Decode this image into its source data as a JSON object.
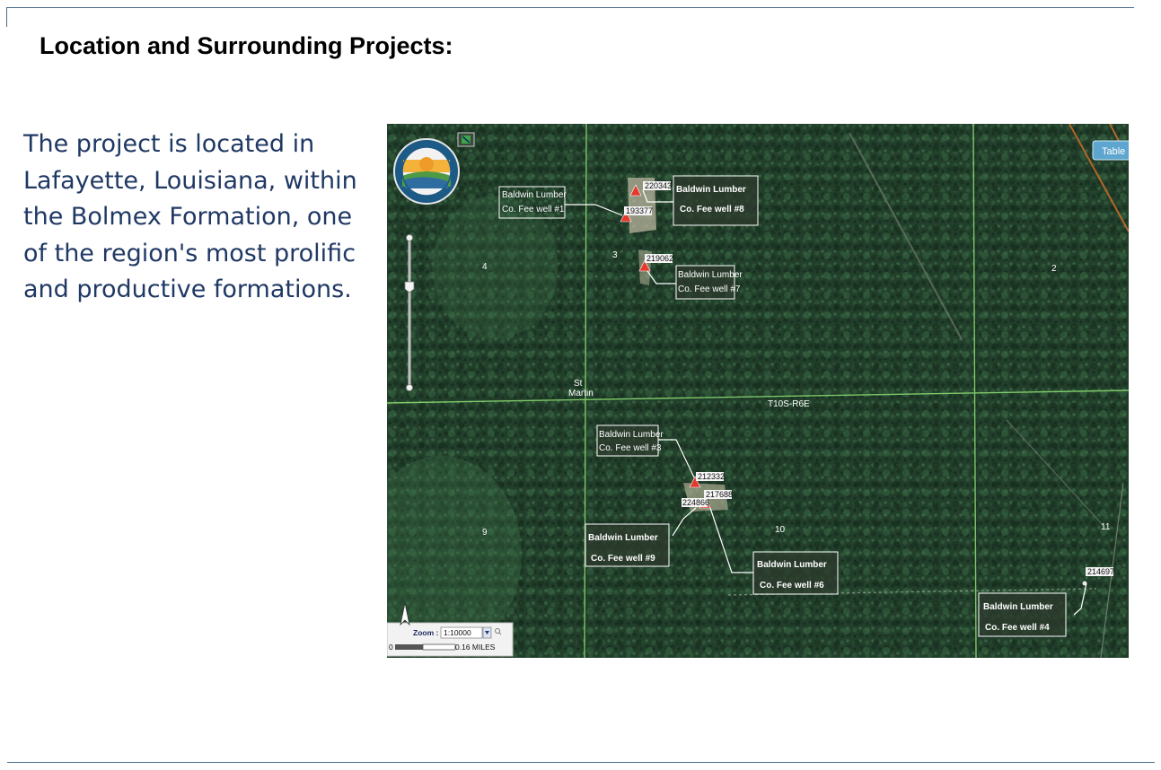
{
  "slide": {
    "title": "Location and Surrounding Projects:",
    "body": "The project is located in Lafayette, Louisiana, within the Bolmex Formation, one of the region's most prolific and productive formations."
  },
  "map": {
    "table_button": "Table",
    "township_label": "T10S-R6E",
    "place_label_line1": "St",
    "place_label_line2": "Martin",
    "sections": [
      "4",
      "3",
      "2",
      "9",
      "10",
      "11"
    ],
    "well_ids": [
      "220343",
      "193377",
      "219062",
      "212332",
      "217688",
      "224866",
      "214697"
    ],
    "callouts": [
      {
        "line1": "Baldwin Lumber",
        "line2": "Co. Fee well #1"
      },
      {
        "line1": "Baldwin Lumber",
        "line2": "Co. Fee well #8"
      },
      {
        "line1": "Baldwin Lumber",
        "line2": "Co. Fee well #7"
      },
      {
        "line1": "Baldwin Lumber",
        "line2": "Co. Fee well #3"
      },
      {
        "line1": "Baldwin Lumber",
        "line2": "Co. Fee well #9"
      },
      {
        "line1": "Baldwin Lumber",
        "line2": "Co. Fee well #6"
      },
      {
        "line1": "Baldwin Lumber",
        "line2": "Co. Fee  well #4"
      }
    ],
    "zoom_label": "Zoom :",
    "zoom_value": "1:10000",
    "scale_start": "0",
    "scale_end": "0.16 MILES",
    "colors": {
      "grid_line": "#7fc96a",
      "well_marker": "#e23b2e",
      "forest": "#1f3a27",
      "text_navy": "#1f3864"
    }
  }
}
